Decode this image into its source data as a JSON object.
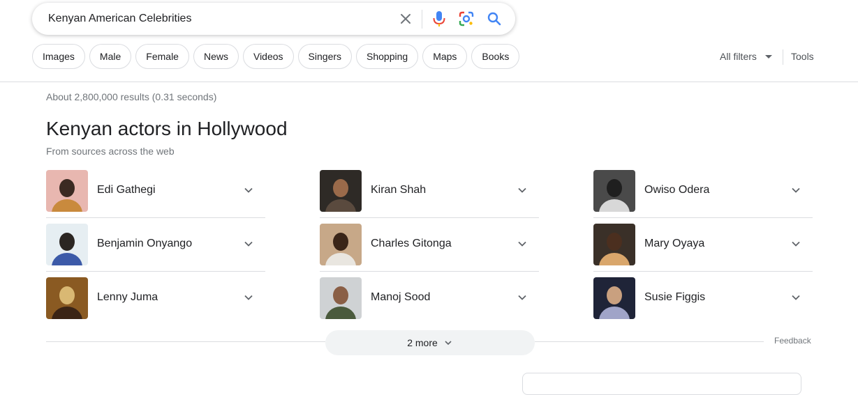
{
  "search": {
    "query": "Kenyan American Celebrities"
  },
  "chips": [
    "Images",
    "Male",
    "Female",
    "News",
    "Videos",
    "Singers",
    "Shopping",
    "Maps",
    "Books"
  ],
  "toolbar": {
    "all_filters": "All filters",
    "tools": "Tools"
  },
  "stats": "About 2,800,000 results (0.31 seconds)",
  "section": {
    "title": "Kenyan actors in Hollywood",
    "subtitle": "From sources across the web"
  },
  "people": [
    {
      "name": "Edi Gathegi",
      "photo_bg": "#e8b7b0",
      "figure": "#3b2a22",
      "accent": "#c98a3d"
    },
    {
      "name": "Kiran Shah",
      "photo_bg": "#2e2a26",
      "figure": "#9a6a4a",
      "accent": "#5a4a3e"
    },
    {
      "name": "Owiso Odera",
      "photo_bg": "#4a4a4a",
      "figure": "#1f1f1f",
      "accent": "#d8d8d8"
    },
    {
      "name": "Benjamin Onyango",
      "photo_bg": "#e6eef2",
      "figure": "#2b2622",
      "accent": "#3c5aa8"
    },
    {
      "name": "Charles Gitonga",
      "photo_bg": "#c7a888",
      "figure": "#3a2518",
      "accent": "#e9e6e0"
    },
    {
      "name": "Mary Oyaya",
      "photo_bg": "#3a3028",
      "figure": "#4b2f1f",
      "accent": "#d9a66b"
    },
    {
      "name": "Lenny Juma",
      "photo_bg": "#8a5a22",
      "figure": "#d9b873",
      "accent": "#3b2415"
    },
    {
      "name": "Manoj Sood",
      "photo_bg": "#cfd2d4",
      "figure": "#8a5f46",
      "accent": "#4a5a3c"
    },
    {
      "name": "Susie Figgis",
      "photo_bg": "#1f2438",
      "figure": "#c9a07f",
      "accent": "#a0a4c8"
    }
  ],
  "more": "2 more",
  "feedback": "Feedback",
  "colors": {
    "mic_blue": "#4285f4",
    "mic_red": "#ea4335",
    "lens_yellow": "#fbbc05",
    "lens_green": "#34a853",
    "search_blue": "#4285f4"
  }
}
